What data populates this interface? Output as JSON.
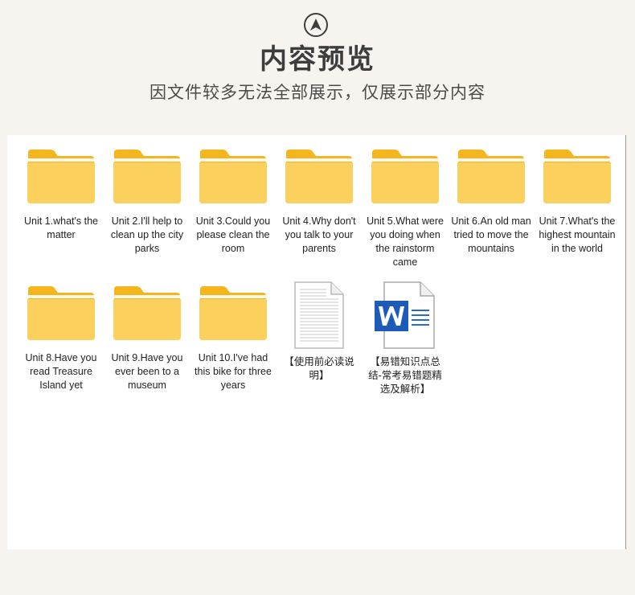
{
  "header": {
    "nav_icon": "navigation-arrow-icon",
    "title": "内容预览",
    "subtitle": "因文件较多无法全部展示，仅展示部分内容"
  },
  "files": [
    {
      "label": "Unit 1.what's the matter",
      "icon": "folder-icon"
    },
    {
      "label": "Unit 2.I'll help to clean up the city parks",
      "icon": "folder-icon"
    },
    {
      "label": "Unit 3.Could you please clean the room",
      "icon": "folder-icon"
    },
    {
      "label": "Unit 4.Why don't you talk to your parents",
      "icon": "folder-icon"
    },
    {
      "label": "Unit 5.What were you doing when the rainstorm came",
      "icon": "folder-icon"
    },
    {
      "label": "Unit 6.An old man tried to move the mountains",
      "icon": "folder-icon"
    },
    {
      "label": "Unit 7.What's the highest mountain in the world",
      "icon": "folder-icon"
    },
    {
      "label": "Unit 8.Have you read Treasure Island yet",
      "icon": "folder-icon"
    },
    {
      "label": "Unit 9.Have you ever been to a museum",
      "icon": "folder-icon"
    },
    {
      "label": "Unit 10.I've had this bike for three years",
      "icon": "folder-icon"
    },
    {
      "label": "【使用前必读说明】",
      "icon": "text-document-icon"
    },
    {
      "label": "【易错知识点总结-常考易错题精选及解析】",
      "icon": "word-document-icon"
    }
  ],
  "colors": {
    "background": "#f7f4ef",
    "folder_back": "#f4b61c",
    "folder_front": "#fcd05c"
  }
}
